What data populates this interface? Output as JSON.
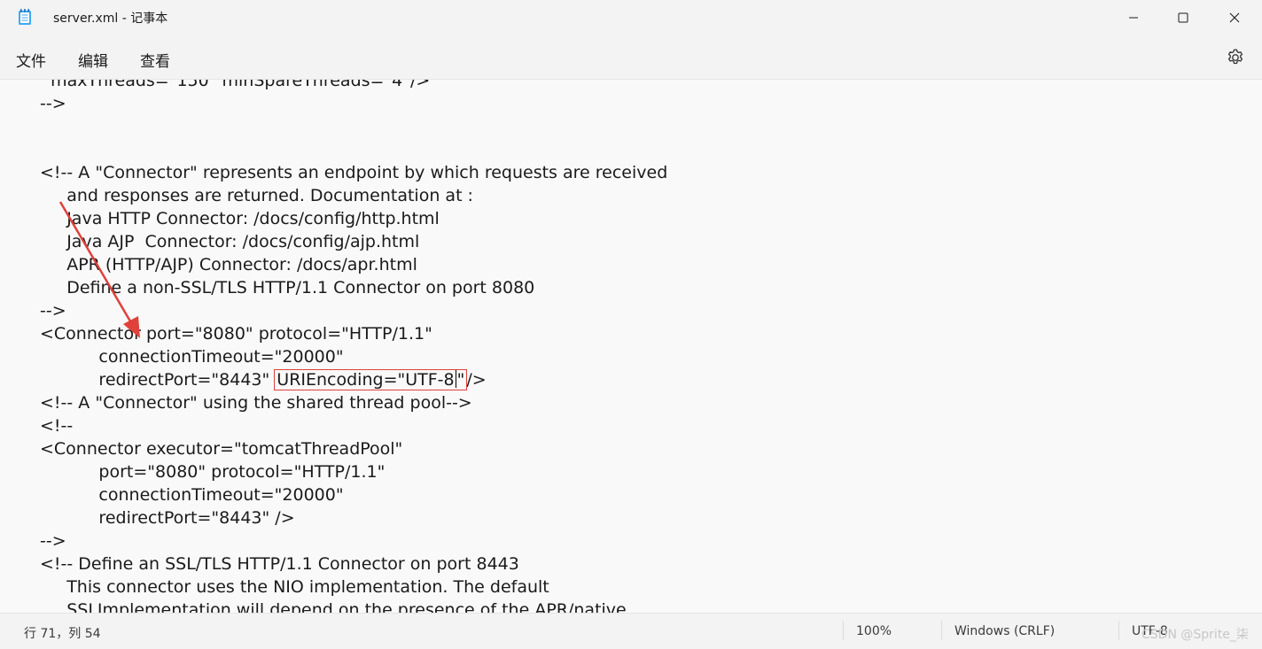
{
  "window": {
    "title": "server.xml - 记事本",
    "minimize_icon": "minimize-icon",
    "maximize_icon": "maximize-icon",
    "close_icon": "close-icon"
  },
  "menu": {
    "items": [
      "文件",
      "编辑",
      "查看"
    ],
    "settings_icon": "gear-icon"
  },
  "editor": {
    "lines": [
      "  maxThreads=\"150\" minSpareThreads=\"4\"/>",
      "-->",
      "",
      "",
      "<!-- A \"Connector\" represents an endpoint by which requests are received",
      "     and responses are returned. Documentation at :",
      "     Java HTTP Connector: /docs/config/http.html",
      "     Java AJP  Connector: /docs/config/ajp.html",
      "     APR (HTTP/AJP) Connector: /docs/apr.html",
      "     Define a non-SSL/TLS HTTP/1.1 Connector on port 8080",
      "-->",
      "<Connector port=\"8080\" protocol=\"HTTP/1.1\"",
      "           connectionTimeout=\"20000\"",
      "",
      "<!-- A \"Connector\" using the shared thread pool-->",
      "<!--",
      "<Connector executor=\"tomcatThreadPool\"",
      "           port=\"8080\" protocol=\"HTTP/1.1\"",
      "           connectionTimeout=\"20000\"",
      "           redirectPort=\"8443\" />",
      "-->",
      "<!-- Define an SSL/TLS HTTP/1.1 Connector on port 8443",
      "     This connector uses the NIO implementation. The default",
      "     SSLImplementation will depend on the presence of the APR/native"
    ],
    "highlight_line": {
      "prefix": "           redirectPort=\"8443\" ",
      "highlighted_before_caret": "URIEncoding=\"UTF-8",
      "highlighted_after_caret": "\"",
      "suffix": "/>"
    },
    "highlight_color": "#e0413b"
  },
  "status": {
    "position": "行 71，列 54",
    "zoom": "100%",
    "line_ending": "Windows (CRLF)",
    "encoding": "UTF-8",
    "watermark": "CSDN @Sprite_柒"
  }
}
